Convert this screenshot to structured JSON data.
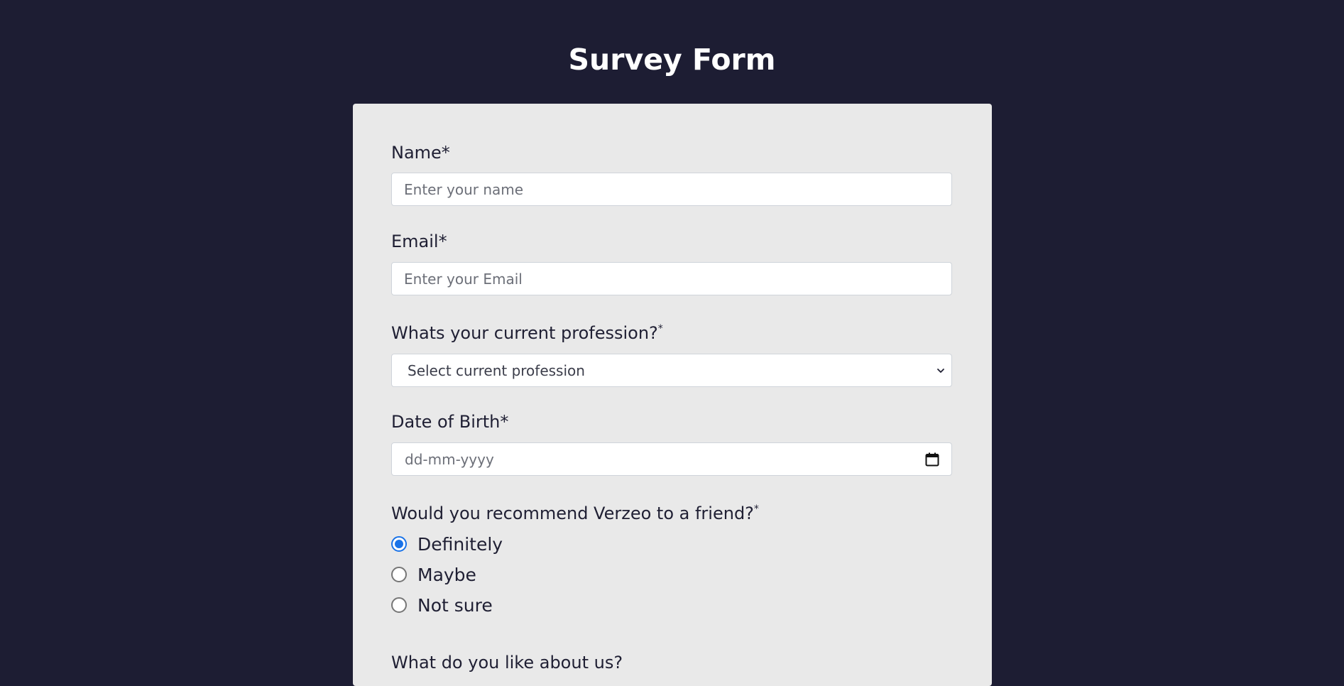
{
  "title": "Survey Form",
  "form": {
    "name": {
      "label": "Name*",
      "placeholder": "Enter your name"
    },
    "email": {
      "label": "Email*",
      "placeholder": "Enter your Email"
    },
    "profession": {
      "label": "Whats your current profession?",
      "required_mark": "*",
      "selected": "Select current profession"
    },
    "dob": {
      "label": "Date of Birth*",
      "placeholder": "dd-mm-yyyy"
    },
    "recommend": {
      "label": "Would you recommend Verzeo to a friend?",
      "required_mark": "*",
      "options": [
        "Definitely",
        "Maybe",
        "Not sure"
      ],
      "selected": "Definitely"
    },
    "like": {
      "label": "What do you like about us?"
    }
  },
  "colors": {
    "background": "#1d1d33",
    "card": "#e9e9e9",
    "accent": "#1a73e8"
  },
  "icons": {
    "select": "chevron-down-icon",
    "date": "calendar-icon"
  }
}
